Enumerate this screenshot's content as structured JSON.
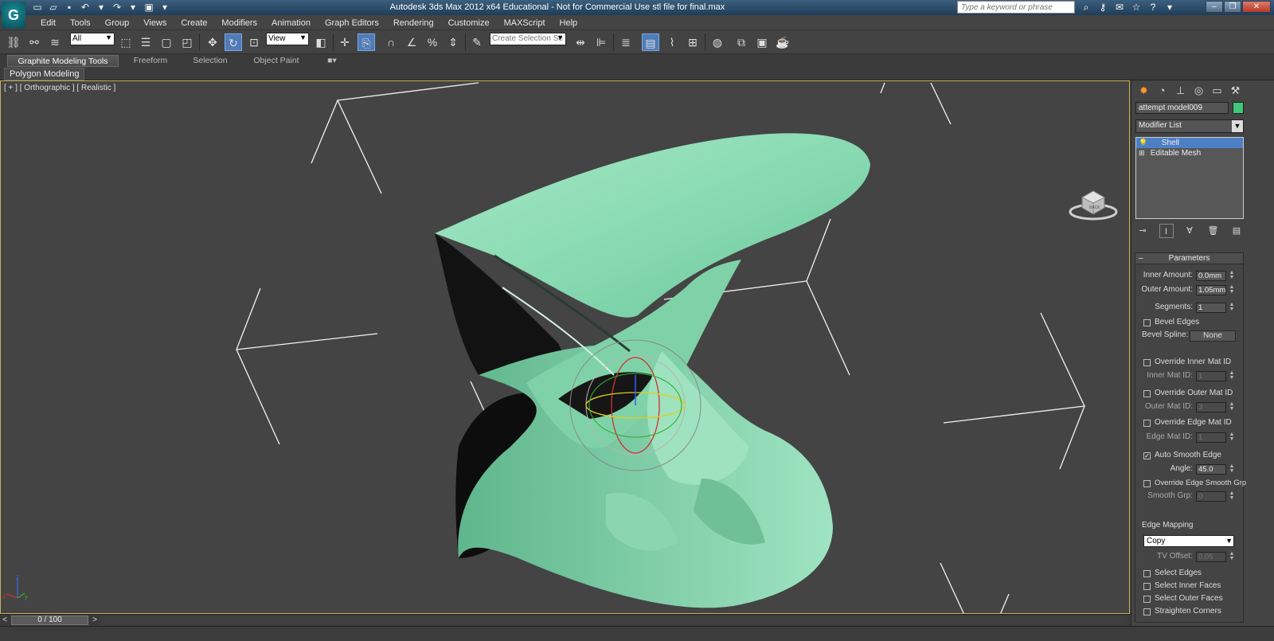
{
  "window": {
    "title": "Autodesk 3ds Max  2012 x64   Educational - Not for Commercial Use    stl file for final.max",
    "search_placeholder": "Type a keyword or phrase"
  },
  "menu": [
    "Edit",
    "Tools",
    "Group",
    "Views",
    "Create",
    "Modifiers",
    "Animation",
    "Graph Editors",
    "Rendering",
    "Customize",
    "MAXScript",
    "Help"
  ],
  "toolbar": {
    "selection_filter": "All",
    "ref_coord": "View",
    "named_selection_placeholder": "Create Selection Se"
  },
  "ribbon": {
    "tabs": [
      "Graphite Modeling Tools",
      "Freeform",
      "Selection",
      "Object Paint"
    ],
    "active_tab": "Graphite Modeling Tools",
    "subpanel": "Polygon Modeling"
  },
  "viewport": {
    "label": "[ + ] [ Orthographic ] [ Realistic ]",
    "viewcube_label": "BACK",
    "object_color": "#8fdcb4",
    "border_color": "#c9b25a"
  },
  "command_panel": {
    "object_name": "attempt model009",
    "object_color": "#3ec878",
    "modifier_list_label": "Modifier List",
    "stack": [
      {
        "label": "Shell",
        "selected": true
      },
      {
        "label": "Editable Mesh",
        "selected": false
      }
    ],
    "rollout_title": "Parameters",
    "inner_amount_label": "Inner Amount:",
    "inner_amount": "0.0mm",
    "outer_amount_label": "Outer Amount:",
    "outer_amount": "1.05mm",
    "segments_label": "Segments:",
    "segments": "1",
    "bevel_edges_label": "Bevel Edges",
    "bevel_spline_label": "Bevel Spline:",
    "bevel_spline_value": "None",
    "override_inner_label": "Override Inner Mat ID",
    "inner_mat_label": "Inner Mat ID:",
    "inner_mat": "1",
    "override_outer_label": "Override Outer Mat ID",
    "outer_mat_label": "Outer Mat ID:",
    "outer_mat": "3",
    "override_edge_label": "Override Edge Mat ID",
    "edge_mat_label": "Edge Mat ID:",
    "edge_mat": "1",
    "auto_smooth_label": "Auto Smooth Edge",
    "auto_smooth_checked": true,
    "angle_label": "Angle:",
    "angle": "45.0",
    "override_smooth_label": "Override Edge Smooth Grp",
    "smooth_grp_label": "Smooth Grp:",
    "smooth_grp": "0",
    "edge_mapping_label": "Edge Mapping",
    "edge_mapping_value": "Copy",
    "tv_offset_label": "TV Offset:",
    "tv_offset": "0.05",
    "select_edges_label": "Select Edges",
    "select_inner_label": "Select Inner Faces",
    "select_outer_label": "Select Outer Faces",
    "straighten_label": "Straighten Corners"
  },
  "timeline": {
    "frame_display": "0 / 100"
  }
}
